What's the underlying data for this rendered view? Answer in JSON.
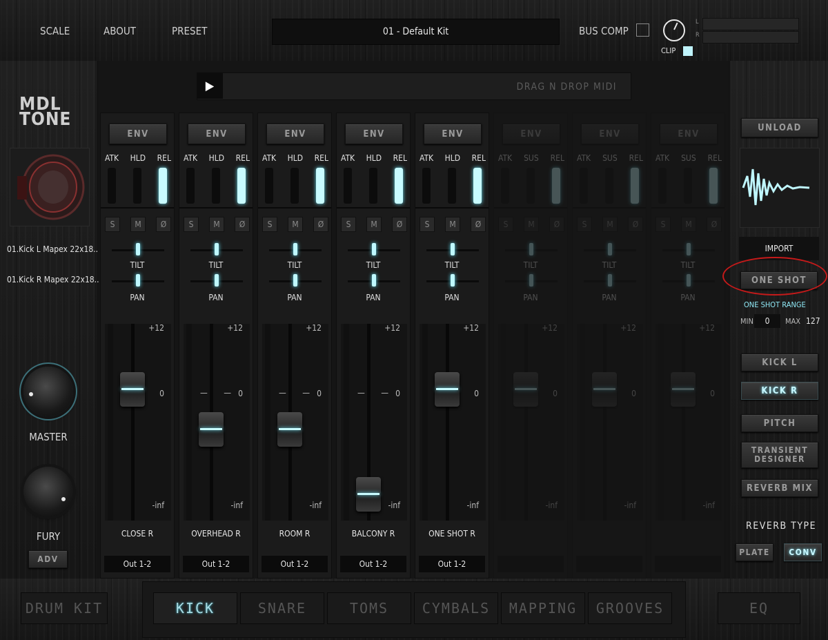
{
  "topbar": {
    "scale": "SCALE",
    "about": "ABOUT",
    "preset": "PRESET",
    "preset_name": "01 - Default Kit",
    "bus_comp": "BUS COMP",
    "clip": "CLIP",
    "meter_left": "L",
    "meter_right": "R"
  },
  "left": {
    "logo_line1": "MDL",
    "logo_line2": "TONE",
    "mic1": "01.Kick L Mapex 22x18...",
    "mic2": "01.Kick R Mapex 22x18...",
    "master_label": "MASTER",
    "fury_label": "FURY",
    "adv_label": "ADV"
  },
  "midi": {
    "play_icon": "▶",
    "label": "DRAG N DROP MIDI"
  },
  "channels": [
    {
      "env": "ENV",
      "a": "ATK",
      "h": "HLD",
      "r": "REL",
      "s": "S",
      "m": "M",
      "p": "Ø",
      "tilt": "TILT",
      "pan": "PAN",
      "top": "+12",
      "zero": "0",
      "inf": "-inf",
      "dash": "— —",
      "name": "CLOSE R",
      "out": "Out 1-2",
      "fader_db": 0
    },
    {
      "env": "ENV",
      "a": "ATK",
      "h": "HLD",
      "r": "REL",
      "s": "S",
      "m": "M",
      "p": "Ø",
      "tilt": "TILT",
      "pan": "PAN",
      "top": "+12",
      "zero": "0",
      "inf": "-inf",
      "dash": "— —",
      "name": "OVERHEAD R",
      "out": "Out 1-2",
      "fader_db": -5
    },
    {
      "env": "ENV",
      "a": "ATK",
      "h": "HLD",
      "r": "REL",
      "s": "S",
      "m": "M",
      "p": "Ø",
      "tilt": "TILT",
      "pan": "PAN",
      "top": "+12",
      "zero": "0",
      "inf": "-inf",
      "dash": "— —",
      "name": "ROOM R",
      "out": "Out 1-2",
      "fader_db": -5
    },
    {
      "env": "ENV",
      "a": "ATK",
      "h": "HLD",
      "r": "REL",
      "s": "S",
      "m": "M",
      "p": "Ø",
      "tilt": "TILT",
      "pan": "PAN",
      "top": "+12",
      "zero": "0",
      "inf": "-inf",
      "dash": "— —",
      "name": "BALCONY R",
      "out": "Out 1-2",
      "fader_db": -13
    },
    {
      "env": "ENV",
      "a": "ATK",
      "h": "HLD",
      "r": "REL",
      "s": "S",
      "m": "M",
      "p": "Ø",
      "tilt": "TILT",
      "pan": "PAN",
      "top": "+12",
      "zero": "0",
      "inf": "-inf",
      "dash": "— —",
      "name": "ONE SHOT R",
      "out": "Out 1-2",
      "fader_db": 0
    },
    {
      "env": "ENV",
      "a": "ATK",
      "h": "SUS",
      "r": "REL",
      "s": "S",
      "m": "M",
      "p": "Ø",
      "tilt": "TILT",
      "pan": "PAN",
      "top": "+12",
      "zero": "0",
      "inf": "-inf",
      "dash": "— —",
      "name": "",
      "out": "",
      "fader_db": 0
    },
    {
      "env": "ENV",
      "a": "ATK",
      "h": "SUS",
      "r": "REL",
      "s": "S",
      "m": "M",
      "p": "Ø",
      "tilt": "TILT",
      "pan": "PAN",
      "top": "+12",
      "zero": "0",
      "inf": "-inf",
      "dash": "— —",
      "name": "",
      "out": "",
      "fader_db": 0
    },
    {
      "env": "ENV",
      "a": "ATK",
      "h": "SUS",
      "r": "REL",
      "s": "S",
      "m": "M",
      "p": "Ø",
      "tilt": "TILT",
      "pan": "PAN",
      "top": "+12",
      "zero": "0",
      "inf": "-inf",
      "dash": "— —",
      "name": "",
      "out": "",
      "fader_db": 0
    }
  ],
  "right": {
    "unload": "UNLOAD",
    "import": "IMPORT",
    "one_shot": "ONE SHOT",
    "one_shot_range": "ONE SHOT RANGE",
    "min_label": "MIN",
    "min_value": "0",
    "max_label": "MAX",
    "max_value": "127",
    "kick_l": "KICK L",
    "kick_r": "KICK R",
    "pitch": "PITCH",
    "transient_1": "TRANSIENT",
    "transient_2": "DESIGNER",
    "reverb_mix": "REVERB MIX",
    "reverb_type": "REVERB TYPE",
    "plate": "PLATE",
    "conv": "CONV"
  },
  "tabs": {
    "drum_kit": "DRUM KIT",
    "kick": "KICK",
    "snare": "SNARE",
    "toms": "TOMS",
    "cymbals": "CYMBALS",
    "mapping": "MAPPING",
    "grooves": "GROOVES",
    "eq": "EQ"
  },
  "colors": {
    "accent": "#c8fbff",
    "annotation": "#c61a1a"
  }
}
